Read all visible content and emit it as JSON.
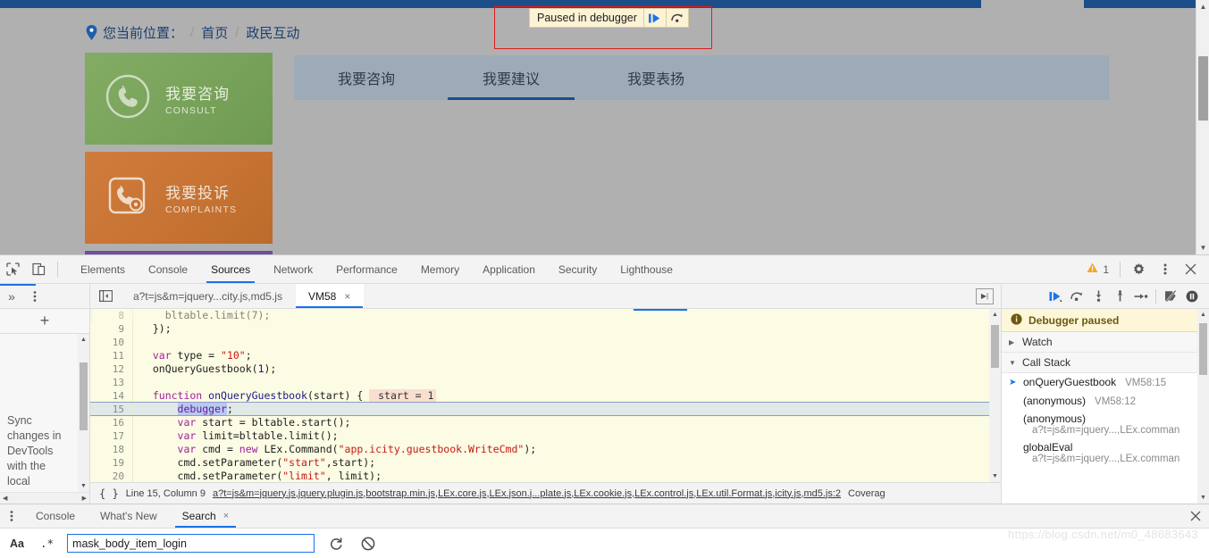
{
  "webpage": {
    "breadcrumb": {
      "label": "您当前位置：",
      "sep": "/",
      "items": [
        "首页",
        "政民互动"
      ]
    },
    "cards": [
      {
        "title": "我要咨询",
        "subtitle": "CONSULT",
        "color": "#7aa45c",
        "icon": "phone-circle-icon"
      },
      {
        "title": "我要投诉",
        "subtitle": "COMPLAINTS",
        "color": "#c87434",
        "icon": "phone-gear-icon"
      }
    ],
    "tabs": [
      {
        "label": "我要咨询",
        "active": false
      },
      {
        "label": "我要建议",
        "active": true
      },
      {
        "label": "我要表扬",
        "active": false
      }
    ],
    "accent": "#1c4e8a"
  },
  "paused_overlay": {
    "message": "Paused in debugger",
    "resume_icon": "resume-script-icon",
    "step_icon": "step-over-icon",
    "outline_color": "#e01b1b",
    "background": "#fdf3d4"
  },
  "devtools": {
    "panels": [
      "Elements",
      "Console",
      "Sources",
      "Network",
      "Performance",
      "Memory",
      "Application",
      "Security",
      "Lighthouse"
    ],
    "active_panel": "Sources",
    "inspect_icon": "inspect-element-icon",
    "device_icon": "device-toolbar-icon",
    "warning_count": "1",
    "warning_icon": "warning-triangle-icon",
    "settings_icon": "gear-icon",
    "kebab_icon": "more-vertical-icon",
    "close_icon": "close-icon",
    "accent": "#1a73e8"
  },
  "navigator": {
    "more_icon": "more-vertical-icon",
    "plus_icon": "plus-icon",
    "hint_text": "Sync changes in DevTools with the local"
  },
  "editor": {
    "back_icon": "collapse-sidebar-icon",
    "popout_icon": "popout-panel-icon",
    "tabs": [
      {
        "label": "a?t=js&m=jquery...city.js,md5.js",
        "active": false,
        "closable": false
      },
      {
        "label": "VM58",
        "active": true,
        "closable": true,
        "close": "×"
      }
    ],
    "lines": [
      {
        "no": "8",
        "segments": [
          {
            "t": "plain",
            "s": "    bltable.limit(7);"
          }
        ],
        "clipped": true
      },
      {
        "no": "9",
        "segments": [
          {
            "t": "plain",
            "s": "  });"
          }
        ]
      },
      {
        "no": "10",
        "segments": [
          {
            "t": "plain",
            "s": ""
          }
        ]
      },
      {
        "no": "11",
        "segments": [
          {
            "t": "kw",
            "s": "  var "
          },
          {
            "t": "plain",
            "s": "type = "
          },
          {
            "t": "str",
            "s": "\"10\""
          },
          {
            "t": "plain",
            "s": ";"
          }
        ]
      },
      {
        "no": "12",
        "segments": [
          {
            "t": "plain",
            "s": "  onQueryGuestbook("
          },
          {
            "t": "num",
            "s": "1"
          },
          {
            "t": "plain",
            "s": ");"
          }
        ]
      },
      {
        "no": "13",
        "segments": [
          {
            "t": "plain",
            "s": ""
          }
        ]
      },
      {
        "no": "14",
        "segments": [
          {
            "t": "kw",
            "s": "  function "
          },
          {
            "t": "fn",
            "s": "onQueryGuestbook"
          },
          {
            "t": "plain",
            "s": "(start) { "
          },
          {
            "t": "hint",
            "s": " start = 1"
          }
        ],
        "fn_line": true
      },
      {
        "no": "15",
        "segments": [
          {
            "t": "plain",
            "s": "      "
          },
          {
            "t": "dbg",
            "s": "debugger"
          },
          {
            "t": "plain",
            "s": ";"
          }
        ],
        "executing": true
      },
      {
        "no": "16",
        "segments": [
          {
            "t": "kw",
            "s": "      var "
          },
          {
            "t": "plain",
            "s": "start = bltable.start();"
          }
        ]
      },
      {
        "no": "17",
        "segments": [
          {
            "t": "kw",
            "s": "      var "
          },
          {
            "t": "plain",
            "s": "limit=bltable.limit();"
          }
        ]
      },
      {
        "no": "18",
        "segments": [
          {
            "t": "kw",
            "s": "      var "
          },
          {
            "t": "plain",
            "s": "cmd = "
          },
          {
            "t": "kw",
            "s": "new "
          },
          {
            "t": "plain",
            "s": "LEx.Command("
          },
          {
            "t": "str",
            "s": "\"app.icity.guestbook.WriteCmd\""
          },
          {
            "t": "plain",
            "s": ");"
          }
        ]
      },
      {
        "no": "19",
        "segments": [
          {
            "t": "plain",
            "s": "      cmd.setParameter("
          },
          {
            "t": "str",
            "s": "\"start\""
          },
          {
            "t": "plain",
            "s": ",start);"
          }
        ]
      },
      {
        "no": "20",
        "segments": [
          {
            "t": "plain",
            "s": "      cmd.setParameter("
          },
          {
            "t": "str",
            "s": "\"limit\""
          },
          {
            "t": "plain",
            "s": ", limit);"
          }
        ]
      }
    ]
  },
  "status_bar": {
    "format_icon": "pretty-print-icon",
    "format_glyph": "{ }",
    "position": "Line 15, Column 9",
    "source_link": "a?t=js&m=jquery.js,jquery.plugin.js,bootstrap.min.js,LEx.core.js,LEx.json.j...plate.js,LEx.cookie.js,LEx.control.js,LEx.util.Format.js,icity.js,md5.js:2",
    "coverage": "Coverag"
  },
  "debugger_sidebar": {
    "toolbar": [
      {
        "name": "resume-script-icon",
        "title": "Resume"
      },
      {
        "name": "step-over-icon",
        "title": "Step over"
      },
      {
        "name": "step-into-icon",
        "title": "Step into"
      },
      {
        "name": "step-out-icon",
        "title": "Step out"
      },
      {
        "name": "step-icon",
        "title": "Step"
      },
      {
        "name": "deactivate-breakpoints-icon",
        "title": "Deactivate breakpoints"
      },
      {
        "name": "pause-on-exceptions-icon",
        "title": "Pause on exceptions"
      }
    ],
    "paused_banner": {
      "icon": "info-icon",
      "text": "Debugger paused"
    },
    "sections": [
      {
        "label": "Watch",
        "expanded": false,
        "caret": "▶"
      },
      {
        "label": "Call Stack",
        "expanded": true,
        "caret": "▼"
      }
    ],
    "call_stack": [
      {
        "name": "onQueryGuestbook",
        "location": "VM58:15",
        "selected": true,
        "marker": "➤",
        "sub": ""
      },
      {
        "name": "(anonymous)",
        "location": "VM58:12",
        "selected": false,
        "marker": "",
        "sub": ""
      },
      {
        "name": "(anonymous)",
        "location": "",
        "selected": false,
        "marker": "",
        "sub": "a?t=js&m=jquery...,LEx.comman"
      },
      {
        "name": "globalEval",
        "location": "",
        "selected": false,
        "marker": "",
        "sub": "a?t=js&m=jquery...,LEx.comman"
      }
    ]
  },
  "drawer": {
    "more_icon": "more-vertical-icon",
    "tabs": [
      {
        "label": "Console",
        "active": false,
        "closable": false
      },
      {
        "label": "What's New",
        "active": false,
        "closable": false
      },
      {
        "label": "Search",
        "active": true,
        "closable": true,
        "close": "×"
      }
    ],
    "close_icon": "close-icon",
    "search": {
      "match_case_label": "Aa",
      "regex_label": ".*",
      "value": "mask_body_item_login",
      "placeholder": "",
      "refresh_icon": "refresh-icon",
      "clear_icon": "clear-icon"
    }
  },
  "watermark": {
    "text": "https://blog.csdn.net/m0_48683643"
  }
}
